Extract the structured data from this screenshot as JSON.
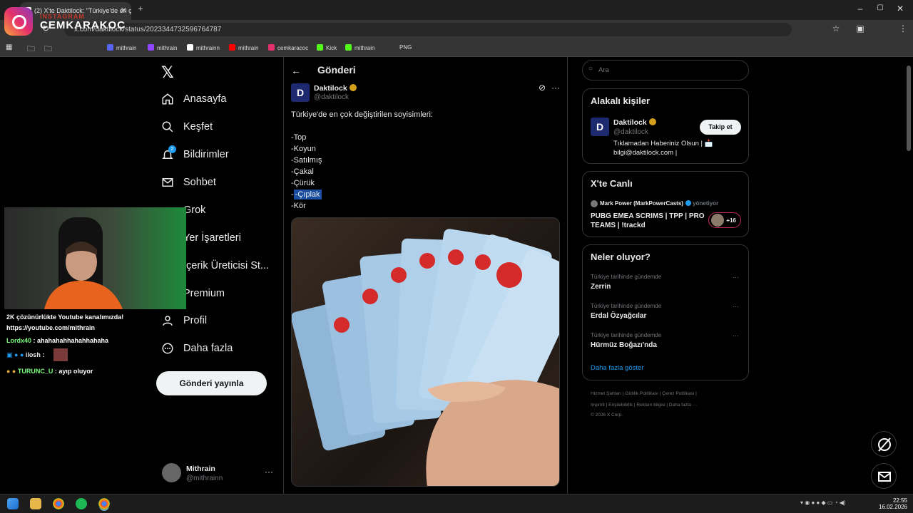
{
  "browser": {
    "tab_title": "(2) X'te Daktilock: \"Türkiye'de en çok",
    "url": "x.com/daktilock/status/2023344732596764787",
    "bookmarks": [
      "mithrain",
      "mithrain",
      "mithrainn",
      "mithrain",
      "cemkaracoc",
      "Kick",
      "mithrain",
      "PNG"
    ]
  },
  "overlay": {
    "insta_label": "INSTAGRAM",
    "insta_name": "CEMKARAKOC"
  },
  "nav": {
    "items": [
      "Anasayfa",
      "Keşfet",
      "Bildirimler",
      "Sohbet",
      "Grok",
      "Yer İşaretleri",
      "İçerik Üreticisi St...",
      "Premium",
      "Profil",
      "Daha fazla"
    ],
    "notif_badge": "2",
    "post_button": "Gönderi yayınla",
    "user_name": "Mithrain",
    "user_handle": "@mithrainn"
  },
  "chat": [
    {
      "user": "",
      "text": "2K çözünürlükte Youtube kanalımızda!"
    },
    {
      "user": "",
      "text": "https://youtube.com/mithrain"
    },
    {
      "user": "Lordx40",
      "text": ": ahahahahhahahhahaha"
    },
    {
      "user": "ilosh",
      "text": ":"
    },
    {
      "user": "TURUNC_U",
      "text": ": ayıp oluyor"
    }
  ],
  "post": {
    "header": "Gönderi",
    "author": "Daktilock",
    "handle": "@daktilock",
    "avatar_letter": "D",
    "intro": "Türkiye'de en çok değiştirilen soyisimleri:",
    "lines": [
      "-Top",
      "-Koyun",
      "-Satılmış",
      " -Çakal",
      "-Çürük",
      "-Çıplak",
      "-Kör"
    ]
  },
  "right": {
    "search_placeholder": "Ara",
    "relevant_title": "Alakalı kişiler",
    "relevant_name": "Daktilock",
    "relevant_handle": "@daktilock",
    "follow": "Takip et",
    "bio": "Tıklamadan Haberiniz Olsun | 📩 bilgi@daktilock.com |",
    "live_title": "X'te Canlı",
    "live_host": "Mark Power (MarkPowerCasts)",
    "live_status": "yönetiyor",
    "live_text": "PUBG EMEA SCRIMS | TPP | PRO TEAMS | !trackd",
    "live_count": "+16",
    "trends_title": "Neler oluyor?",
    "trends": [
      {
        "context": "Türkiye tarihinde gündemde",
        "name": "Zerrin"
      },
      {
        "context": "Türkiye tarihinde gündemde",
        "name": "Erdal Özyağcılar"
      },
      {
        "context": "Türkiye tarihinde gündemde",
        "name": "Hürmüz Boğazı'nda"
      }
    ],
    "show_more": "Daha fazla göster",
    "footer1": "Hizmet Şartları  |  Gizlilik Politikası  |  Çerez Politikası  |",
    "footer2": "Imprint  |  Erişilebilirlik  |  Reklam bilgisi  |  Daha fazla ···",
    "footer3": "© 2026 X Corp."
  },
  "taskbar": {
    "time": "22:55",
    "date": "16.02.2026"
  },
  "colors": {
    "accent": "#1d9bf0",
    "highlight": "#1a4ea0",
    "verified": "#d4a01c"
  }
}
